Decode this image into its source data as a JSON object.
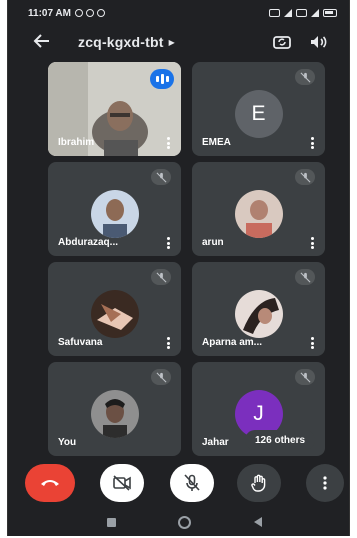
{
  "status_bar": {
    "time": "11:07 AM"
  },
  "header": {
    "meeting_code": "zcq-kgxd-tbt"
  },
  "colors": {
    "background": "#202124",
    "tile": "#3c4043",
    "end_call": "#ea4335",
    "speaking_indicator": "#1a73e8",
    "avatar_emea": "#5f6368",
    "avatar_j": "#7b2fbe"
  },
  "participants": [
    {
      "name": "Ibrahim",
      "video_on": true,
      "speaking": true
    },
    {
      "name": "EMEA",
      "initial": "E",
      "muted": true
    },
    {
      "name": "Abdurazaq...",
      "muted": true
    },
    {
      "name": "arun",
      "muted": true
    },
    {
      "name": "Safuvana",
      "muted": true
    },
    {
      "name": "Aparna am...",
      "muted": true
    },
    {
      "name": "You",
      "muted": true
    },
    {
      "name": "Jahar",
      "initial": "J",
      "muted": true
    }
  ],
  "others_label": "126 others",
  "controls": [
    "end-call",
    "camera-off",
    "mic-off",
    "raise-hand",
    "more-options"
  ]
}
